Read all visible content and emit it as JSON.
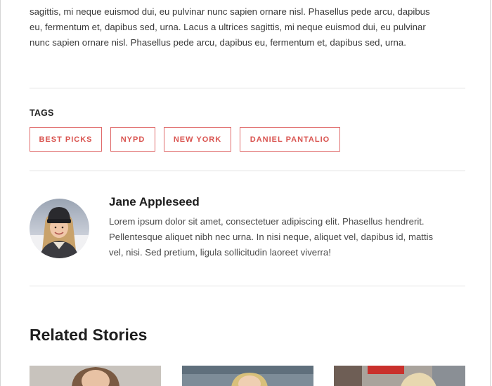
{
  "article": {
    "body_lines": [
      "sagittis, mi neque euismod dui, eu pulvinar nunc sapien ornare nisl. Phasellus pede arcu, dapibus",
      "eu, fermentum et, dapibus sed, urna. Lacus a ultrices sagittis, mi neque euismod dui, eu pulvinar",
      "nunc sapien ornare nisl. Phasellus pede arcu, dapibus eu, fermentum et, dapibus sed, urna."
    ]
  },
  "tags": {
    "heading": "TAGS",
    "items": [
      "BEST PICKS",
      "NYPD",
      "NEW YORK",
      "DANIEL PANTALIO"
    ]
  },
  "author": {
    "name": "Jane Appleseed",
    "bio_lines": [
      "Lorem ipsum dolor sit amet, consectetuer adipiscing elit. Phasellus hendrerit.",
      "Pellentesque aliquet nibh nec urna. In nisi neque, aliquet vel, dapibus id, mattis",
      "vel, nisi. Sed pretium, ligula sollicitudin laoreet viverra!"
    ],
    "avatar_icon": "person-photo"
  },
  "related": {
    "heading": "Related Stories",
    "thumbnails": [
      "story-photo-portrait",
      "story-photo-outdoor",
      "story-photo-street"
    ]
  },
  "colors": {
    "tag_accent": "#d9534f",
    "divider": "#e2e2e2",
    "text": "#3a3a3a"
  }
}
